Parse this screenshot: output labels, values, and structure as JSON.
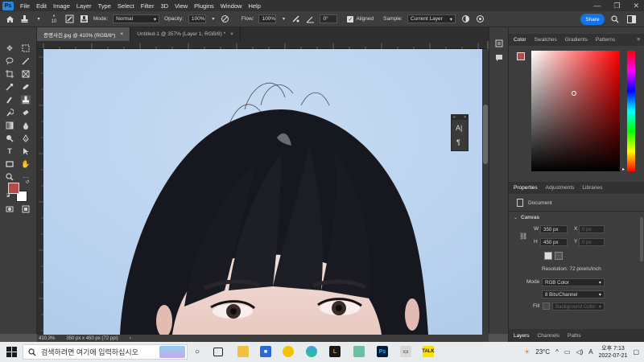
{
  "menu": {
    "logo": "Ps",
    "items": [
      "File",
      "Edit",
      "Image",
      "Layer",
      "Type",
      "Select",
      "Filter",
      "3D",
      "View",
      "Plugins",
      "Window",
      "Help"
    ],
    "window_controls": [
      "—",
      "❐",
      "✕"
    ]
  },
  "options": {
    "brush_size": "10",
    "mode_label": "Mode:",
    "mode_value": "Normal",
    "opacity_label": "Opacity:",
    "opacity_value": "100%",
    "flow_label": "Flow:",
    "flow_value": "100%",
    "angle_value": "0°",
    "aligned_label": "Aligned",
    "aligned_checked": true,
    "sample_label": "Sample:",
    "sample_value": "Current Layer",
    "share_label": "Share"
  },
  "tabs": [
    {
      "label": "증명사진.jpg @ 410% (RGB/8*)",
      "close": "×",
      "active": true
    },
    {
      "label": "Untitled-1 @ 357% (Layer 1, RGB/8) *",
      "close": "×",
      "active": false
    }
  ],
  "status": {
    "zoom": "410.3%",
    "doc_size": "350 px x 450 px (72 ppi)"
  },
  "panels": {
    "color_tabs": [
      "Color",
      "Swatches",
      "Gradients",
      "Patterns"
    ],
    "properties_tabs": [
      "Properties",
      "Adjustments",
      "Libraries"
    ],
    "document_label": "Document",
    "canvas_section": "Canvas",
    "w_label": "W",
    "w_value": "350 px",
    "h_label": "H",
    "h_value": "450 px",
    "x_label": "X",
    "x_value": "0 px",
    "y_label": "Y",
    "y_value": "0 px",
    "resolution": "Resolution: 72 pixels/inch",
    "mode_label": "Mode",
    "mode_value": "RGB Color",
    "bits_value": "8 Bits/Channel",
    "fill_label": "Fill",
    "fill_value": "Background Color",
    "layers_tabs": [
      "Layers",
      "Channels",
      "Paths"
    ],
    "foreground_color": "#b34b4b",
    "background_color": "#ffffff"
  },
  "taskbar": {
    "search_placeholder": "검색하려면 여기에 입력하십시오",
    "temperature": "23°C",
    "ime": "A",
    "time": "오후 7:13",
    "date": "2022-07-21"
  }
}
